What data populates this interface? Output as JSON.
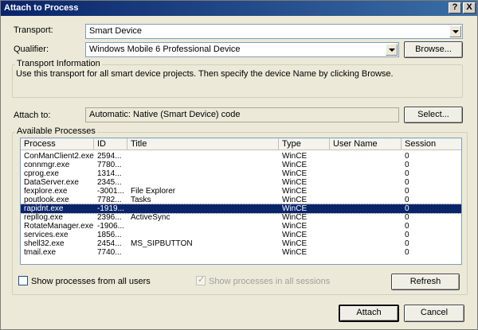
{
  "window": {
    "title": "Attach to Process",
    "help_button": "?",
    "close_button": "X"
  },
  "transport": {
    "label": "Transport:",
    "value": "Smart Device"
  },
  "qualifier": {
    "label": "Qualifier:",
    "value": "Windows Mobile 6 Professional Device",
    "browse_label": "Browse..."
  },
  "transport_info": {
    "title": "Transport Information",
    "text": "Use this transport for all smart device projects. Then specify the device Name by clicking Browse."
  },
  "attach_to": {
    "label": "Attach to:",
    "value": "Automatic: Native (Smart Device) code",
    "select_label": "Select..."
  },
  "available_processes": {
    "title": "Available Processes",
    "columns": [
      "Process",
      "ID",
      "Title",
      "Type",
      "User Name",
      "Session"
    ],
    "rows": [
      {
        "process": "ConManClient2.exe",
        "id": "2594...",
        "title": "",
        "type": "WinCE",
        "user": "",
        "session": "0"
      },
      {
        "process": "connmgr.exe",
        "id": "7780...",
        "title": "",
        "type": "WinCE",
        "user": "",
        "session": "0"
      },
      {
        "process": "cprog.exe",
        "id": "1314...",
        "title": "",
        "type": "WinCE",
        "user": "",
        "session": "0"
      },
      {
        "process": "DataServer.exe",
        "id": "2345...",
        "title": "",
        "type": "WinCE",
        "user": "",
        "session": "0"
      },
      {
        "process": "fexplore.exe",
        "id": "-3001...",
        "title": "File Explorer",
        "type": "WinCE",
        "user": "",
        "session": "0"
      },
      {
        "process": "poutlook.exe",
        "id": "7782...",
        "title": "Tasks",
        "type": "WinCE",
        "user": "",
        "session": "0"
      },
      {
        "process": "rapidnt.exe",
        "id": "-1919...",
        "title": "",
        "type": "WinCE",
        "user": "",
        "session": "0"
      },
      {
        "process": "repllog.exe",
        "id": "2396...",
        "title": "ActiveSync",
        "type": "WinCE",
        "user": "",
        "session": "0"
      },
      {
        "process": "RotateManager.exe",
        "id": "-1906...",
        "title": "",
        "type": "WinCE",
        "user": "",
        "session": "0"
      },
      {
        "process": "services.exe",
        "id": "1856...",
        "title": "",
        "type": "WinCE",
        "user": "",
        "session": "0"
      },
      {
        "process": "shell32.exe",
        "id": "2454...",
        "title": "MS_SIPBUTTON",
        "type": "WinCE",
        "user": "",
        "session": "0"
      },
      {
        "process": "tmail.exe",
        "id": "7740...",
        "title": "",
        "type": "WinCE",
        "user": "",
        "session": "0"
      }
    ],
    "selected_index": 6,
    "show_all_users_label": "Show processes from all users",
    "show_all_sessions_label": "Show processes in all sessions",
    "refresh_label": "Refresh"
  },
  "footer": {
    "attach_label": "Attach",
    "cancel_label": "Cancel"
  }
}
